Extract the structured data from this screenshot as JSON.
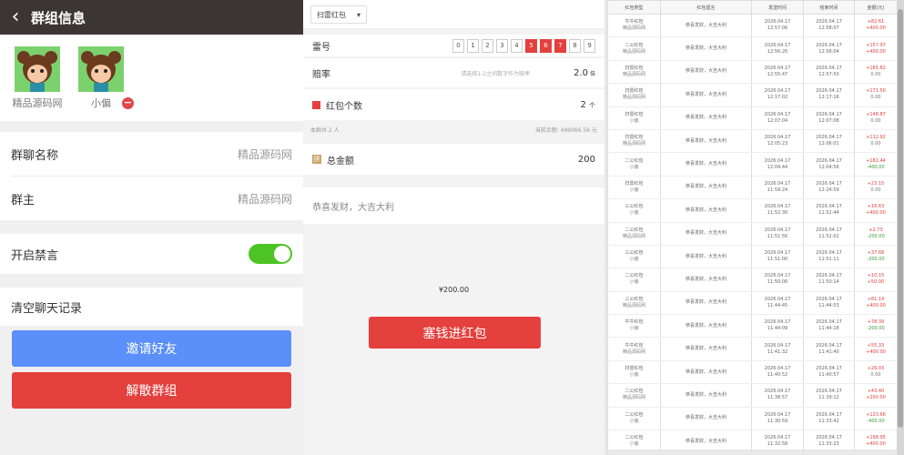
{
  "panel1": {
    "header": {
      "back_icon": "‹",
      "title": "群组信息"
    },
    "members": [
      {
        "name": "精品源码网"
      },
      {
        "name": "小偏"
      }
    ],
    "rows": {
      "group_name_label": "群聊名称",
      "group_name_value": "精品源码网",
      "owner_label": "群主",
      "owner_value": "精品源码网",
      "mute_label": "开启禁言",
      "mute_on": true,
      "clear_label": "清空聊天记录"
    },
    "buttons": {
      "invite": "邀请好友",
      "invite_color": "#5b8ff9",
      "dissolve": "解散群组",
      "dissolve_color": "#e4403d"
    }
  },
  "panel2": {
    "type_select": "扫雷红包",
    "mine_label": "雷号",
    "mine_numbers": [
      "0",
      "1",
      "2",
      "3",
      "4",
      "5",
      "6",
      "7",
      "8",
      "9"
    ],
    "mine_selected": [
      "5",
      "6",
      "7"
    ],
    "odds_label": "赔率",
    "odds_hint": "请选择1-2之间数字作为赔率",
    "odds_value": "2.0",
    "odds_unit": "倍",
    "count_label": "红包个数",
    "count_value": "2",
    "count_unit": "个",
    "group_total": "本群共 2 人",
    "balance": "当前余额: 499066.56 元",
    "total_label": "总金额",
    "total_value": "200",
    "greeting_placeholder": "恭喜发财，大吉大利",
    "amount_display": "¥200.00",
    "submit": "塞钱进红包",
    "accent": "#e4403d"
  },
  "panel3": {
    "headers": [
      "红包类型",
      "红包留言",
      "发送时间",
      "结束时间",
      "金额(元)"
    ],
    "rows": [
      {
        "type": [
          "牛牛红包",
          "精品源码网"
        ],
        "msg": "恭喜发财，大吉大利",
        "send": [
          "2026.04.17",
          "12:57:06"
        ],
        "end": [
          "2026.04.17",
          "12:58:07"
        ],
        "amt": [
          "+82.61",
          "+400.00"
        ]
      },
      {
        "type": [
          "二公红包",
          "精品源码网"
        ],
        "msg": "恭喜发财，大吉大利",
        "send": [
          "2026.04.17",
          "12:56:26"
        ],
        "end": [
          "2026.04.17",
          "12:56:04"
        ],
        "amt": [
          "+157.97",
          "+400.00"
        ]
      },
      {
        "type": [
          "扫雷红包",
          "精品源码网"
        ],
        "msg": "恭喜发财，大吉大利",
        "send": [
          "2026.04.17",
          "12:55:47"
        ],
        "end": [
          "2026.04.17",
          "12:57:50"
        ],
        "amt": [
          "+165.82",
          "0.00"
        ]
      },
      {
        "type": [
          "扫雷红包",
          "精品源码网"
        ],
        "msg": "恭喜发财，大吉大利",
        "send": [
          "2026.04.17",
          "12:17:02"
        ],
        "end": [
          "2026.04.17",
          "12:17:16"
        ],
        "amt": [
          "+171.50",
          "0.00"
        ]
      },
      {
        "type": [
          "扫雷红包",
          "小偏"
        ],
        "msg": "恭喜发财，大吉大利",
        "send": [
          "2026.04.17",
          "12:07:04"
        ],
        "end": [
          "2026.04.17",
          "12:07:08"
        ],
        "amt": [
          "+148.87",
          "0.00"
        ]
      },
      {
        "type": [
          "扫雷红包",
          "精品源码网"
        ],
        "msg": "恭喜发财，大吉大利",
        "send": [
          "2026.04.17",
          "12:05:23"
        ],
        "end": [
          "2026.04.17",
          "12:06:01"
        ],
        "amt": [
          "+112.92",
          "0.00"
        ]
      },
      {
        "type": [
          "二公红包",
          "小偏"
        ],
        "msg": "恭喜发财，大吉大利",
        "send": [
          "2026.04.17",
          "12:04:44"
        ],
        "end": [
          "2026.04.17",
          "12:04:56"
        ],
        "amt": [
          "+182.44",
          "-400.00"
        ]
      },
      {
        "type": [
          "扫雷红包",
          "小偏"
        ],
        "msg": "恭喜发财，大吉大利",
        "send": [
          "2026.04.17",
          "11:59:24"
        ],
        "end": [
          "2026.04.17",
          "12:24:59"
        ],
        "amt": [
          "+23.15",
          "0.00"
        ]
      },
      {
        "type": [
          "三公红包",
          "小偏"
        ],
        "msg": "恭喜发财，大吉大利",
        "send": [
          "2026.04.17",
          "11:52:30"
        ],
        "end": [
          "2026.04.17",
          "11:52:44"
        ],
        "amt": [
          "+16.63",
          "+400.00"
        ]
      },
      {
        "type": [
          "二公红包",
          "精品源码网"
        ],
        "msg": "恭喜发财，大吉大利",
        "send": [
          "2026.04.17",
          "11:51:56"
        ],
        "end": [
          "2026.04.17",
          "11:52:02"
        ],
        "amt": [
          "+2.73",
          "-200.00"
        ]
      },
      {
        "type": [
          "三公红包",
          "小偏"
        ],
        "msg": "恭喜发财，大吉大利",
        "send": [
          "2026.04.17",
          "11:51:00"
        ],
        "end": [
          "2026.04.17",
          "11:51:11"
        ],
        "amt": [
          "+37.68",
          "-200.00"
        ]
      },
      {
        "type": [
          "二公红包",
          "小偏"
        ],
        "msg": "恭喜发财，大吉大利",
        "send": [
          "2026.04.17",
          "11:50:08"
        ],
        "end": [
          "2026.04.17",
          "11:50:14"
        ],
        "amt": [
          "+10.15",
          "+50.00"
        ]
      },
      {
        "type": [
          "三公红包",
          "精品源码网"
        ],
        "msg": "恭喜发财，大吉大利",
        "send": [
          "2026.04.17",
          "11:44:45"
        ],
        "end": [
          "2026.04.17",
          "11:44:53"
        ],
        "amt": [
          "+81.14",
          "+400.00"
        ]
      },
      {
        "type": [
          "牛牛红包",
          "小偏"
        ],
        "msg": "恭喜发财，大吉大利",
        "send": [
          "2026.04.17",
          "11:44:09"
        ],
        "end": [
          "2026.04.17",
          "11:44:18"
        ],
        "amt": [
          "+78.39",
          "-200.00"
        ]
      },
      {
        "type": [
          "牛牛红包",
          "精品源码网"
        ],
        "msg": "恭喜发财，大吉大利",
        "send": [
          "2026.04.17",
          "11:41:32"
        ],
        "end": [
          "2026.04.17",
          "11:41:40"
        ],
        "amt": [
          "+55.33",
          "+400.00"
        ]
      },
      {
        "type": [
          "扫雷红包",
          "小偏"
        ],
        "msg": "恭喜发财，大吉大利",
        "send": [
          "2026.04.17",
          "11:40:52"
        ],
        "end": [
          "2026.04.17",
          "11:40:57"
        ],
        "amt": [
          "+26.03",
          "0.00"
        ]
      },
      {
        "type": [
          "二公红包",
          "精品源码网"
        ],
        "msg": "恭喜发财，大吉大利",
        "send": [
          "2026.04.17",
          "11:38:57"
        ],
        "end": [
          "2026.04.17",
          "11:39:12"
        ],
        "amt": [
          "+43.40",
          "+200.00"
        ]
      },
      {
        "type": [
          "二公红包",
          "小偏"
        ],
        "msg": "恭喜发财，大吉大利",
        "send": [
          "2026.04.17",
          "11:30:59"
        ],
        "end": [
          "2026.04.17",
          "11:33:42"
        ],
        "amt": [
          "+123.66",
          "-400.00"
        ]
      },
      {
        "type": [
          "二公红包",
          "小偏"
        ],
        "msg": "恭喜发财，大吉大利",
        "send": [
          "2026.04.17",
          "11:32:58"
        ],
        "end": [
          "2026.04.17",
          "11:33:23"
        ],
        "amt": [
          "+198.95",
          "+400.00"
        ]
      }
    ]
  }
}
